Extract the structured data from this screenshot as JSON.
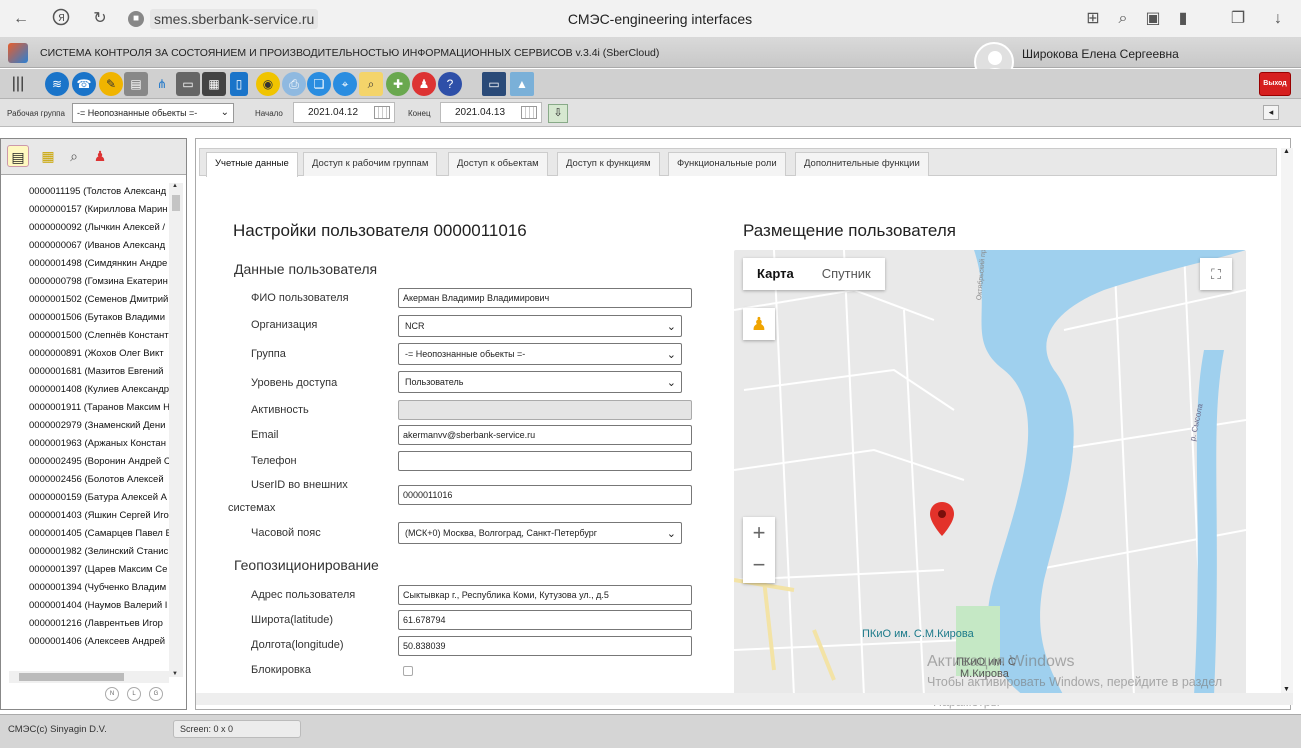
{
  "browser": {
    "url_host": "smes.sberbank-service.ru",
    "page_title": "СМЭС-engineering interfaces",
    "nav_icons": [
      "back-arrow-icon",
      "yandex-icon",
      "reload-icon",
      "lock-icon"
    ],
    "right_icons": [
      "translate-icon",
      "search-page-icon",
      "extensions-icon",
      "bookmark-icon",
      "collections-icon",
      "download-icon"
    ]
  },
  "header": {
    "app_name": "СИСТЕМА КОНТРОЛЯ ЗА СОСТОЯНИЕМ И ПРОИЗВОДИТЕЛЬНОСТЬЮ ИНФОРМАЦИОННЫХ СЕРВИСОВ v.3.4i (SberCloud)",
    "user_name": "Широкова Елена Сергеевна"
  },
  "toolbar": {
    "exit_label": "Выход",
    "icons": [
      "menu-icon",
      "water-icon",
      "dispatch-icon",
      "tools-icon",
      "scanner-icon",
      "network-icon",
      "storage-icon",
      "server-rack-icon",
      "mobile-icon",
      "taxi-icon",
      "printer-icon",
      "documents-icon",
      "location-icon",
      "search-icon",
      "report-icon",
      "users-icon",
      "help-icon",
      "monitor-icon",
      "map-icon"
    ]
  },
  "filters": {
    "work_group_label": "Рабочая группа",
    "work_group_value": "-= Неопознанные обьекты =-",
    "start_label": "Начало",
    "start_value": "2021.04.12",
    "end_label": "Конец",
    "end_value": "2021.04.13"
  },
  "users": [
    "0000011195 (Толстов Александ",
    "0000000157 (Кириллова Марин",
    "0000000092 (Лычкин Алексей /",
    "0000000067 (Иванов Александ",
    "0000001498 (Симдянкин Андре",
    "0000000798 (Гомзина Екатерин",
    "0000001502 (Семенов Дмитрий",
    "0000001506 (Бутаков Владими",
    "0000001500 (Слепнёв Констант",
    "0000000891 (Жохов Олег Викт",
    "0000001681 (Мазитов Евгений",
    "0000001408 (Кулиев Александр",
    "0000001911 (Таранов Максим Н",
    "0000002979 (Знаменский Дени",
    "0000001963 (Аржаных Констан",
    "0000002495 (Воронин Андрей С",
    "0000002456 (Болотов Алексей",
    "0000000159 (Батура Алексей А",
    "0000001403 (Яшкин Сергей Иго",
    "0000001405 (Самарцев Павел Е",
    "0000001982 (Зелинский Станис",
    "0000001397 (Царев Максим Се",
    "0000001394 (Чубченко Владим",
    "0000001404 (Наумов Валерий I",
    "0000001216 (Лаврентьев Игор",
    "0000001406 (Алексеев Андрей"
  ],
  "pager": [
    "N",
    "L",
    "G"
  ],
  "tabs": [
    "Учетные данные",
    "Доступ к рабочим группам",
    "Доступ к обьектам",
    "Доступ к функциям",
    "Функциональные роли",
    "Дополнительные функции"
  ],
  "form": {
    "title": "Настройки пользователя 0000011016",
    "section_user": "Данные пользователя",
    "fio_label": "ФИО пользователя",
    "fio_value": "Акерман Владимир Владимирович",
    "org_label": "Организация",
    "org_value": "NCR",
    "group_label": "Группа",
    "group_value": "-= Неопознанные обьекты =-",
    "access_label": "Уровень доступа",
    "access_value": "Пользователь",
    "activity_label": "Активность",
    "email_label": "Email",
    "email_value": "akermanvv@sberbank-service.ru",
    "phone_label": "Телефон",
    "userid_label_1": "UserID во внешних",
    "userid_label_2": "системах",
    "userid_value": "0000011016",
    "tz_label": "Часовой пояс",
    "tz_value": "(МСК+0) Москва, Волгоград, Санкт-Петербург",
    "section_geo": "Геопозиционирование",
    "address_label": "Адрес пользователя",
    "address_value": "Сыктывкар г., Республика Коми, Кутузова ул., д.5",
    "lat_label": "Широта(latitude)",
    "lat_value": "61.678794",
    "lon_label": "Долгота(longitude)",
    "lon_value": "50.838039",
    "block_label": "Блокировка"
  },
  "map": {
    "title": "Размещение пользователя",
    "type_map": "Карта",
    "type_satellite": "Спутник",
    "zoom_in": "+",
    "zoom_out": "−",
    "park_label": "ПКиО им. С.М.Кирова",
    "park_label2_a": "ПКиО им. С",
    "park_label2_b": "М.Кирова",
    "river_label": "р. Сысола",
    "street_label": "Октябрьский пр."
  },
  "watermark": {
    "line1": "Активация Windows",
    "line2": "Чтобы активировать Windows, перейдите в раздел",
    "line3": "Параметры"
  },
  "statusbar": {
    "copyright": "СМЭС(с) Sinyagin D.V.",
    "screen": "Screen:  0 x 0"
  },
  "colors": {
    "accent_blue": "#1a74c9",
    "exit_red": "#d61f1f",
    "map_water": "#9fd0ee",
    "map_park": "#c5e8c5",
    "map_pin": "#e3322a"
  }
}
